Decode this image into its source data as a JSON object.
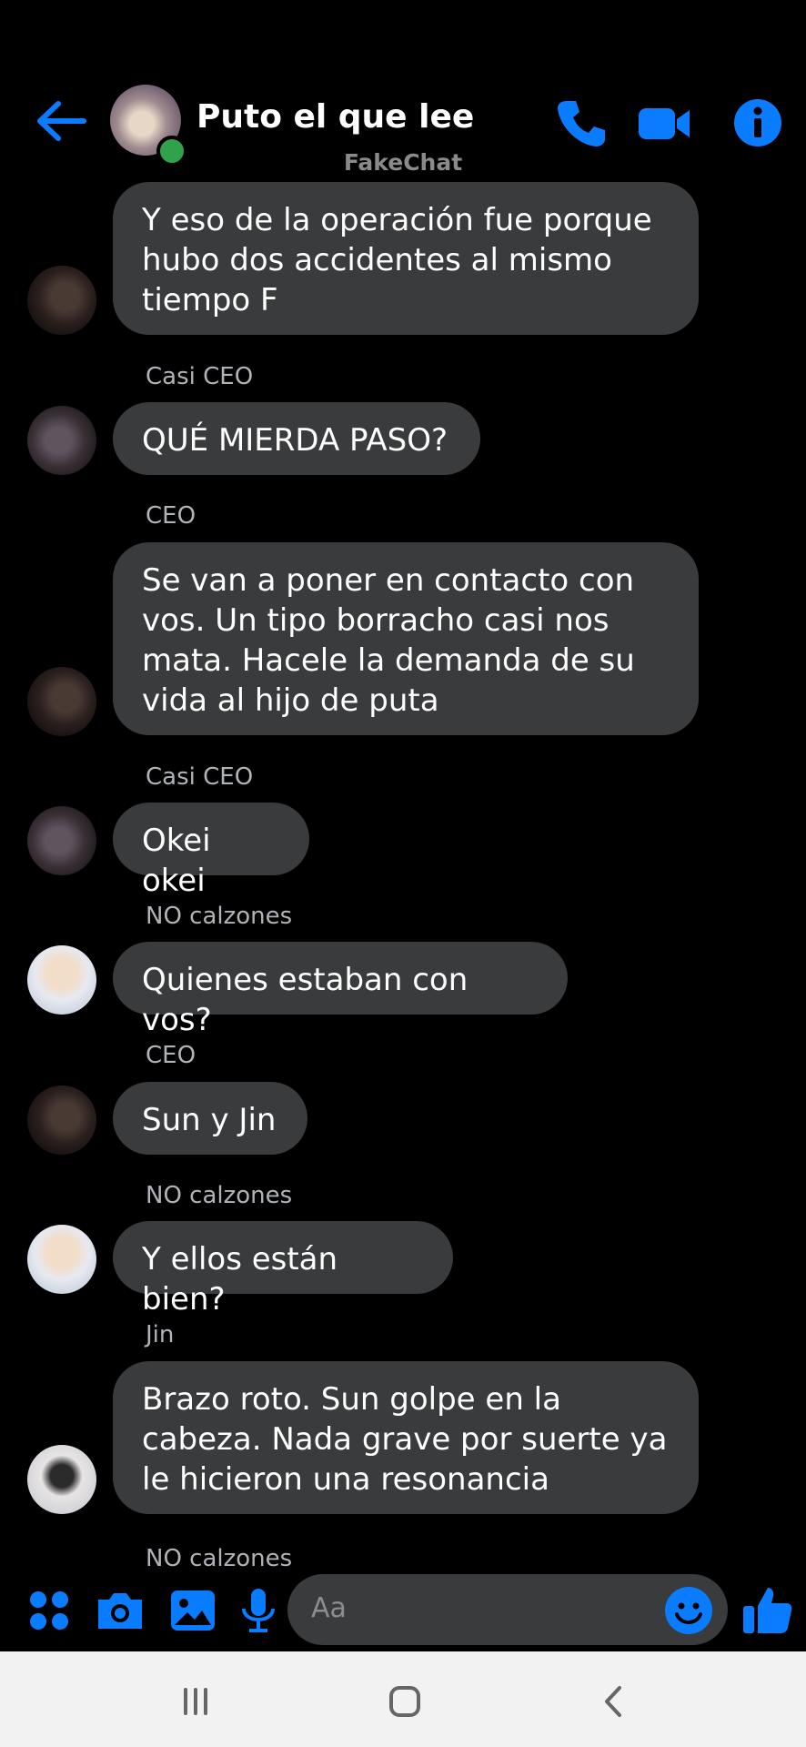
{
  "header": {
    "title": "Puto el que lee",
    "watermark": "FakeChat",
    "icons": [
      "back-arrow-icon",
      "phone-icon",
      "video-camera-icon",
      "info-icon"
    ]
  },
  "messages": [
    {
      "sender": "",
      "text": "Y eso de la operación fue porque\nhubo dos accidentes al mismo\ntiempo F"
    },
    {
      "sender": "Casi CEO",
      "text": "QUÉ MIERDA PASO?"
    },
    {
      "sender": "CEO",
      "text": "Se van a poner en contacto con\nvos. Un tipo borracho casi nos\nmata. Hacele la demanda de su\nvida al hijo de puta"
    },
    {
      "sender": "Casi CEO",
      "text": "Okei okei"
    },
    {
      "sender": "NO calzones",
      "text": "Quienes estaban con vos?"
    },
    {
      "sender": "CEO",
      "text": "Sun y Jin"
    },
    {
      "sender": "NO calzones",
      "text": "Y ellos están bien?"
    },
    {
      "sender": "Jin",
      "text": "Brazo roto. Sun golpe en la\ncabeza. Nada grave por suerte ya\nle hicieron una resonancia"
    },
    {
      "sender": "NO calzones",
      "text": ""
    }
  ],
  "composer": {
    "placeholder": "Aa",
    "icons": [
      "apps-grid-icon",
      "camera-icon",
      "gallery-icon",
      "microphone-icon",
      "emoji-icon",
      "thumbs-up-icon"
    ]
  },
  "colors": {
    "accent": "#0a7cff",
    "bubble": "#3a3b3c",
    "online": "#31a24c"
  }
}
